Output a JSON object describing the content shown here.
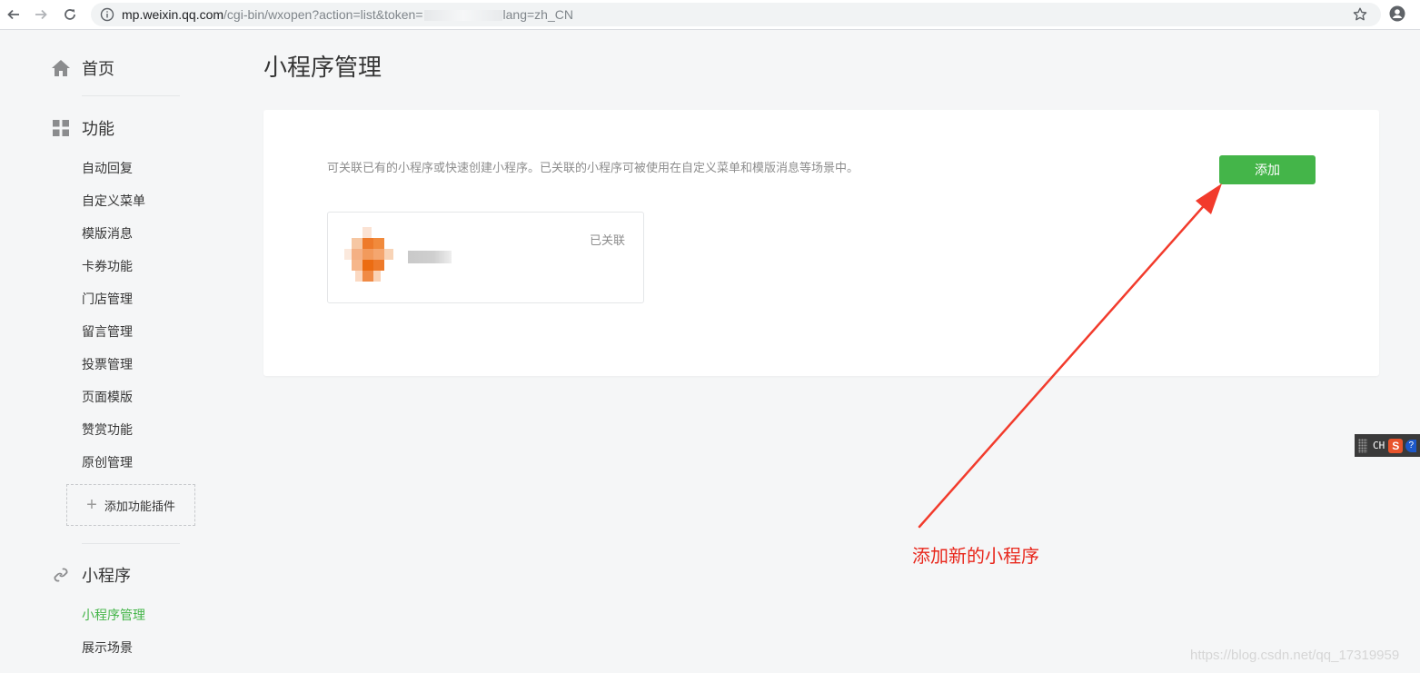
{
  "browser": {
    "url_host": "mp.weixin.qq.com",
    "url_path": "/cgi-bin/wxopen?action=list&token=",
    "url_tail": "lang=zh_CN",
    "back_icon": "arrow-left-icon",
    "forward_icon": "arrow-right-icon",
    "reload_icon": "reload-icon",
    "info_icon": "info-icon",
    "bookmark_icon": "star-icon",
    "account_icon": "account-icon"
  },
  "sidebar": {
    "home": {
      "label": "首页",
      "icon": "home-icon"
    },
    "functions": {
      "label": "功能",
      "icon": "grid-icon",
      "items": [
        "自动回复",
        "自定义菜单",
        "模版消息",
        "卡券功能",
        "门店管理",
        "留言管理",
        "投票管理",
        "页面模版",
        "赞赏功能",
        "原创管理"
      ]
    },
    "add_plugin_label": "添加功能插件",
    "miniprogram": {
      "label": "小程序",
      "icon": "link-icon",
      "items": [
        "小程序管理",
        "展示场景"
      ],
      "active_item": "小程序管理"
    }
  },
  "main": {
    "title": "小程序管理",
    "intro": "可关联已有的小程序或快速创建小程序。已关联的小程序可被使用在自定义菜单和模版消息等场景中。",
    "add_button": "添加",
    "linked_app": {
      "status": "已关联"
    }
  },
  "ime": {
    "lang": "CH",
    "logo": "S",
    "help": "?"
  },
  "annotation": {
    "text": "添加新的小程序"
  },
  "watermark": "https://blog.csdn.net/qq_17319959",
  "colors": {
    "accent_green": "#44b549",
    "annotation_red": "#e8271c",
    "background": "#f5f6f7"
  }
}
